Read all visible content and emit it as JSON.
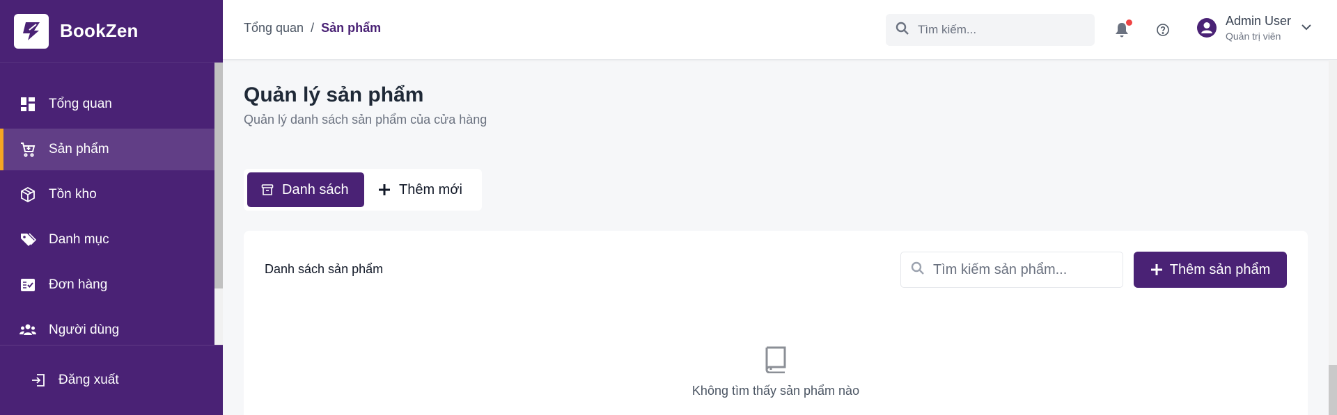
{
  "brand": {
    "name": "BookZen"
  },
  "sidebar": {
    "items": [
      {
        "label": "Tổng quan",
        "icon": "dashboard-icon"
      },
      {
        "label": "Sản phẩm",
        "icon": "cart-icon",
        "active": true
      },
      {
        "label": "Tồn kho",
        "icon": "box-icon"
      },
      {
        "label": "Danh mục",
        "icon": "tags-icon"
      },
      {
        "label": "Đơn hàng",
        "icon": "checklist-icon"
      },
      {
        "label": "Người dùng",
        "icon": "users-icon"
      }
    ],
    "logout_label": "Đăng xuất"
  },
  "header": {
    "breadcrumb": {
      "parent": "Tổng quan",
      "separator": "/",
      "current": "Sản phẩm"
    },
    "search_placeholder": "Tìm kiếm...",
    "user": {
      "name": "Admin User",
      "role": "Quản trị viên"
    }
  },
  "main": {
    "title": "Quản lý sản phẩm",
    "subtitle": "Quản lý danh sách sản phẩm của cửa hàng",
    "tabs": [
      {
        "label": "Danh sách",
        "active": true
      },
      {
        "label": "Thêm mới"
      }
    ],
    "card": {
      "title": "Danh sách sản phẩm",
      "search_placeholder": "Tìm kiếm sản phẩm...",
      "add_button": "Thêm sản phẩm",
      "empty_text": "Không tìm thấy sản phẩm nào"
    }
  },
  "colors": {
    "brand": "#4a2275",
    "accent": "#f5a623",
    "notification": "#ef4444"
  }
}
